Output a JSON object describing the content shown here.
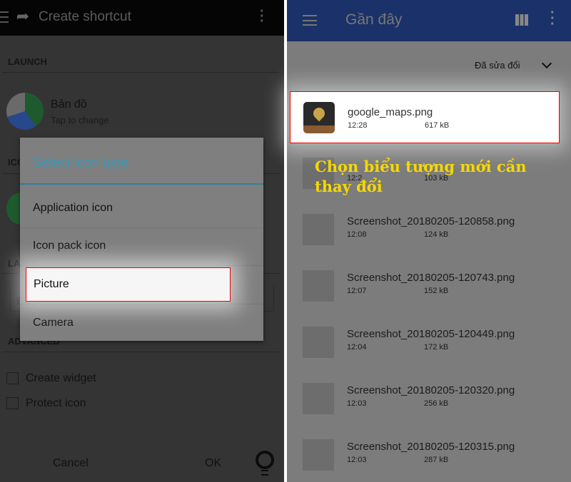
{
  "left": {
    "title": "Create shortcut",
    "sections": {
      "launch": "LAUNCH",
      "icon": "ICO",
      "label": "LA",
      "advanced": "ADVANCED"
    },
    "app": {
      "name": "Bản đồ",
      "hint": "Tap to change"
    },
    "label_input_value": "B",
    "checkboxes": [
      {
        "label": "Create widget",
        "checked": false
      },
      {
        "label": "Protect icon",
        "checked": false
      }
    ],
    "cancel": "Cancel",
    "ok": "OK",
    "dialog": {
      "title": "Select icon type",
      "options": [
        "Application icon",
        "Icon pack icon",
        "Picture",
        "Camera"
      ],
      "selected": "Picture"
    },
    "accent": "#3a9ab8"
  },
  "right": {
    "title": "Gần đây",
    "sort": "Đã sửa đổi",
    "header_color": "#1b3169",
    "files": [
      {
        "name": "google_maps.png",
        "time": "12:28",
        "size": "617 kB"
      },
      {
        "name": "",
        "time": "12:2",
        "size": "103 kB"
      },
      {
        "name": "Screenshot_20180205-120858.png",
        "time": "12:08",
        "size": "124 kB"
      },
      {
        "name": "Screenshot_20180205-120743.png",
        "time": "12:07",
        "size": "152 kB"
      },
      {
        "name": "Screenshot_20180205-120449.png",
        "time": "12:04",
        "size": "172 kB"
      },
      {
        "name": "Screenshot_20180205-120320.png",
        "time": "12:03",
        "size": "256 kB"
      },
      {
        "name": "Screenshot_20180205-120315.png",
        "time": "12:03",
        "size": "287 kB"
      }
    ],
    "caption": "Chọn biểu tượng mới cần thay đổi"
  }
}
